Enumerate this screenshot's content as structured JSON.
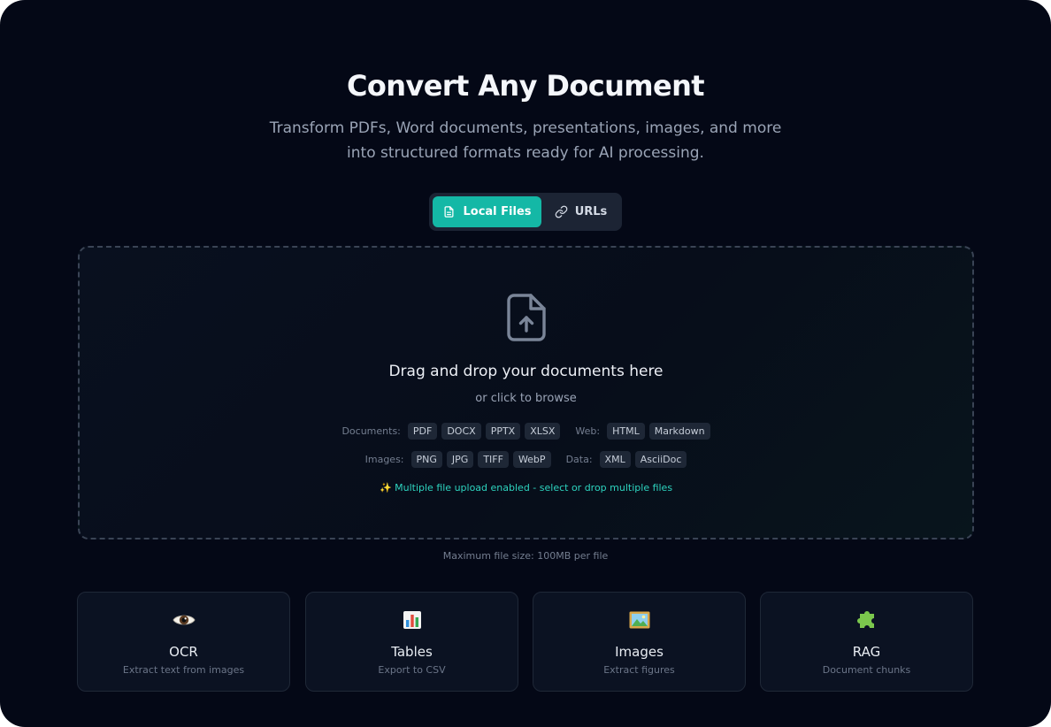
{
  "hero": {
    "title": "Convert Any Document",
    "subtitle": "Transform PDFs, Word documents, presentations, images, and more into structured formats ready for AI processing."
  },
  "mode_switch": {
    "active_tab": "Local Files",
    "tabs": [
      {
        "label": "Local Files",
        "icon": "file-icon",
        "active": true
      },
      {
        "label": "URLs",
        "icon": "link-icon",
        "active": false
      }
    ]
  },
  "dropzone": {
    "icon": "file-upload-icon",
    "title": "Drag and drop your documents here",
    "hint": "or click to browse",
    "format_groups": [
      {
        "label": "Documents:",
        "formats": [
          "PDF",
          "DOCX",
          "PPTX",
          "XLSX"
        ]
      },
      {
        "label": "Web:",
        "formats": [
          "HTML",
          "Markdown"
        ]
      },
      {
        "label": "Images:",
        "formats": [
          "PNG",
          "JPG",
          "TIFF",
          "WebP"
        ]
      },
      {
        "label": "Data:",
        "formats": [
          "XML",
          "AsciiDoc"
        ]
      }
    ],
    "multi_note": "✨ Multiple file upload enabled - select or drop multiple files"
  },
  "max_size_note": "Maximum file size: 100MB per file",
  "features": [
    {
      "icon": "eye-icon",
      "title": "OCR",
      "description": "Extract text from images"
    },
    {
      "icon": "bar-chart-icon",
      "title": "Tables",
      "description": "Export to CSV"
    },
    {
      "icon": "picture-icon",
      "title": "Images",
      "description": "Extract figures"
    },
    {
      "icon": "puzzle-icon",
      "title": "RAG",
      "description": "Document chunks"
    }
  ],
  "colors": {
    "background": "#040816",
    "accent": "#14b8a6",
    "accent_text": "#2dd4bf",
    "card_bg": "#0b1222"
  }
}
